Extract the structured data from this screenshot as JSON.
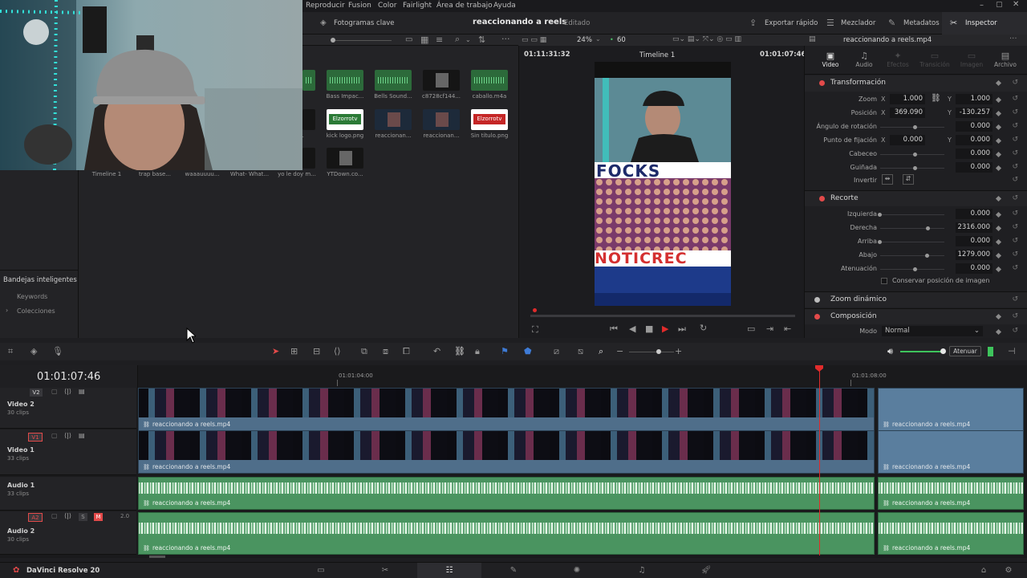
{
  "menu": [
    "Reproducir",
    "Fusion",
    "Color",
    "Fairlight",
    "Área de trabajo",
    "Ayuda"
  ],
  "toolbar": {
    "keyframes_label": "Fotogramas clave",
    "project_title": "reaccionando a reels",
    "project_status": "Editado",
    "export_label": "Exportar rápido",
    "mixer_label": "Mezclador",
    "metadata_label": "Metadatos",
    "inspector_label": "Inspector",
    "zoom": "24%",
    "fps": "60",
    "clip_name": "reaccionando a reels.mp4"
  },
  "media": [
    {
      "label": "",
      "kind": "audio"
    },
    {
      "label": "Bass Impac...",
      "kind": "audio"
    },
    {
      "label": "Bells Sound...",
      "kind": "audio"
    },
    {
      "label": "c8728cf144...",
      "kind": "image"
    },
    {
      "label": "caballo.m4a",
      "kind": "audio"
    },
    {
      "label": "",
      "kind": "image"
    },
    {
      "label": "kick logo.png",
      "kind": "logo",
      "logo_text": "Elzorrotv"
    },
    {
      "label": "reaccionan...",
      "kind": "video"
    },
    {
      "label": "reaccionan...",
      "kind": "video"
    },
    {
      "label": "Sin título.png",
      "kind": "logo2",
      "logo_text": "Elzorrotv"
    },
    {
      "label": "",
      "kind": "image"
    },
    {
      "label": "YTDown.co...",
      "kind": "image"
    }
  ],
  "media_bottom_row": [
    "Timeline 1",
    "trap base...",
    "waaauuuu...",
    "What- What...",
    "yo le doy m..."
  ],
  "partial_labels": [
    "mo..."
  ],
  "sidebar": {
    "smart_bins": "Bandejas inteligentes",
    "keywords": "Keywords",
    "collections": "Colecciones"
  },
  "viewer": {
    "source_tc": "01:11:31:32",
    "timeline_name": "Timeline 1",
    "record_tc": "01:01:07:46",
    "overlay_top": "FOCKS",
    "overlay_bottom": "NOTICREC"
  },
  "inspector": {
    "tabs": [
      "Video",
      "Audio",
      "Efectos",
      "Transición",
      "Imagen",
      "Archivo"
    ],
    "sections": {
      "transform": "Transformación",
      "crop": "Recorte",
      "dynamic_zoom": "Zoom dinámico",
      "composite": "Composición"
    },
    "transform": {
      "zoom_label": "Zoom",
      "zoom_x": "1.000",
      "zoom_y": "1.000",
      "pos_label": "Posición",
      "pos_x": "369.090",
      "pos_y": "-130.257",
      "rot_label": "Ángulo de rotación",
      "rot": "0.000",
      "anchor_label": "Punto de fijación",
      "anchor_x": "0.000",
      "anchor_y": "0.000",
      "pitch_label": "Cabeceo",
      "pitch": "0.000",
      "yaw_label": "Guiñada",
      "yaw": "0.000",
      "flip_label": "Invertir"
    },
    "crop": {
      "left_label": "Izquierda",
      "left": "0.000",
      "right_label": "Derecha",
      "right": "2316.000",
      "top_label": "Arriba",
      "top": "0.000",
      "bottom_label": "Abajo",
      "bottom": "1279.000",
      "soft_label": "Atenuación",
      "soft": "0.000",
      "retain_label": "Conservar posición de imagen"
    },
    "mode_label": "Modo",
    "mode_value": "Normal"
  },
  "timeline": {
    "timecode": "01:01:07:46",
    "ruler": [
      "01:01:04:00",
      "01:01:08:00"
    ],
    "mix_label": "Atenuar",
    "tracks": [
      {
        "id": "V2",
        "name": "Video 2",
        "clips": "30 clips",
        "clip": "reaccionando a reels.mp4"
      },
      {
        "id": "V1",
        "name": "Video 1",
        "clips": "33 clips",
        "clip": "reaccionando a reels.mp4"
      },
      {
        "id": "A1",
        "name": "Audio 1",
        "clips": "33 clips",
        "clip": "reaccionando a reels.mp4"
      },
      {
        "id": "A2",
        "name": "Audio 2",
        "clips": "30 clips",
        "clip": "reaccionando a reels.mp4",
        "level": "2.0",
        "solo": "S",
        "mute": "M"
      }
    ]
  },
  "app": {
    "name": "DaVinci Resolve 20"
  },
  "colors": {
    "accent_red": "#e34a4a",
    "video_clip": "#4f6e8a",
    "audio_clip": "#4a9460",
    "playhead": "#e12b2b"
  },
  "icons": [
    "search-icon",
    "grid-icon",
    "list-icon",
    "play-icon",
    "stop-icon",
    "prev-icon",
    "next-icon",
    "loop-icon",
    "link-icon",
    "lock-icon",
    "flag-icon",
    "speaker-icon",
    "home-icon",
    "gear-icon"
  ]
}
